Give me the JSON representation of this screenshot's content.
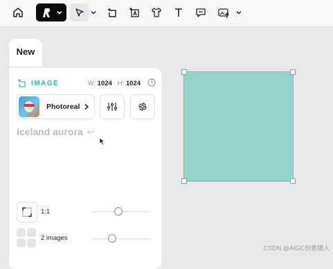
{
  "toolbar": {
    "tools": [
      "home-icon",
      "brand-logo",
      "select-tool-icon",
      "frame-add-icon",
      "text-image-icon",
      "shirt-icon",
      "text-tool-icon",
      "comment-icon",
      "image-upload-icon"
    ]
  },
  "tab": {
    "label": "New"
  },
  "panel": {
    "section_label": "IMAGE",
    "width_label": "W:",
    "width_value": "1024",
    "height_label": "H:",
    "height_value": "1024",
    "style_name": "Photoreal",
    "prompt_text": "iceland aurora",
    "prompt_return": "↩",
    "aspect_ratio": "1:1",
    "image_count": "2 images",
    "aspect_slider_level": 0.45,
    "count_slider_level": 0.35
  },
  "canvas": {
    "fill_color": "#94d2cb",
    "accent": "#3fb3a4"
  },
  "watermark": "CSDN @AIGC创意猎人"
}
